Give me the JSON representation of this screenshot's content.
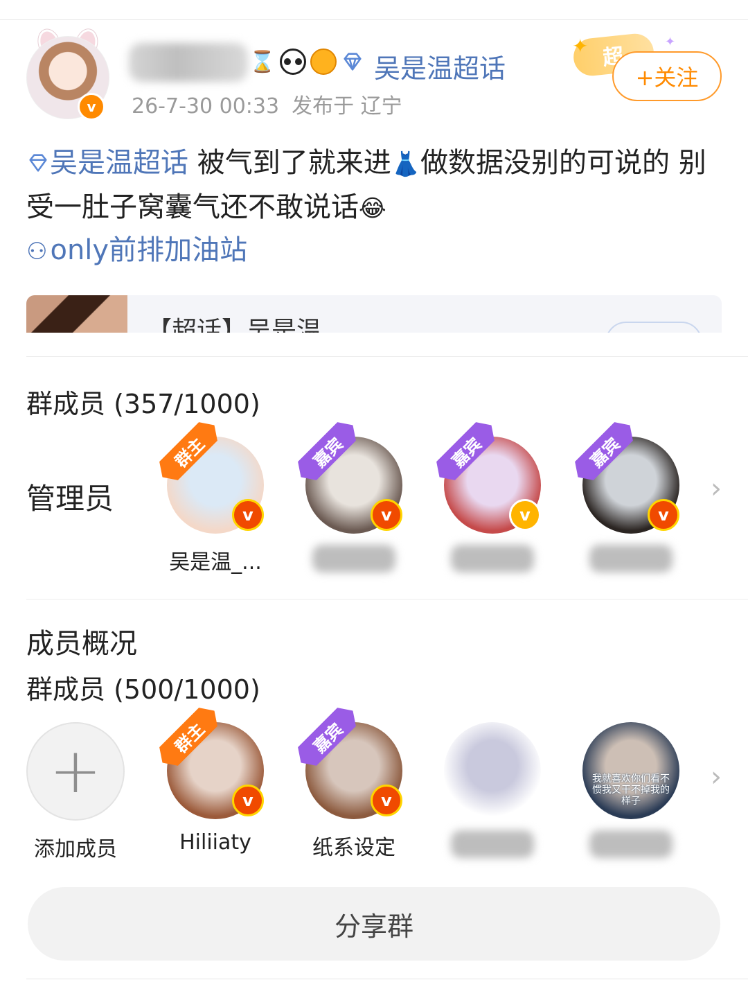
{
  "post": {
    "supertopic_link": "吴是温超话",
    "date": "26-7-30 00:33",
    "location": "发布于 辽宁",
    "supertag": "超",
    "follow_label": "+关注",
    "text_topic": "吴是温超话",
    "text_part1": " 被气到了就来进",
    "text_part2": "做数据没别的可说的 别受一肚子窝囊气还不敢说话",
    "group_link": "only前排加油站",
    "topic_card_title": "【超话】吴是温"
  },
  "admins": {
    "title": "群成员 (357/1000)",
    "row_label": "管理员",
    "members": [
      {
        "name": "吴是温_...",
        "ribbon": "群主",
        "colors": [
          "#dbe9f6",
          "#f4d8c8"
        ]
      },
      {
        "name": "",
        "ribbon": "嘉宾",
        "colors": [
          "#e8e3dd",
          "#6b5a52"
        ]
      },
      {
        "name": "",
        "ribbon": "嘉宾",
        "colors": [
          "#e9d8f0",
          "#c54a4a"
        ]
      },
      {
        "name": "",
        "ribbon": "嘉宾",
        "colors": [
          "#cfd3d8",
          "#2b2522"
        ]
      }
    ]
  },
  "overview": {
    "title": "成员概况",
    "subtitle": "群成员 (500/1000)",
    "add_label": "添加成员",
    "members": [
      {
        "name": "Hiliiaty",
        "ribbon": "群主",
        "colors": [
          "#e6d3c8",
          "#9b5a3a"
        ]
      },
      {
        "name": "纸系设定",
        "ribbon": "嘉宾",
        "colors": [
          "#d7c6bc",
          "#8c5a3e"
        ]
      },
      {
        "name": "",
        "ribbon": "",
        "colors": [
          "#c9c9dd",
          "#ffffff"
        ]
      },
      {
        "name": "",
        "ribbon": "",
        "colors": [
          "#cdbfb5",
          "#2a3b55"
        ],
        "caption": "我就喜欢你们看不惯我又干不掉我的样子"
      }
    ]
  },
  "share_label": "分享群",
  "colors": {
    "link": "#4f76b8",
    "orange": "#ff8a00",
    "purple": "#9a5ce6"
  }
}
